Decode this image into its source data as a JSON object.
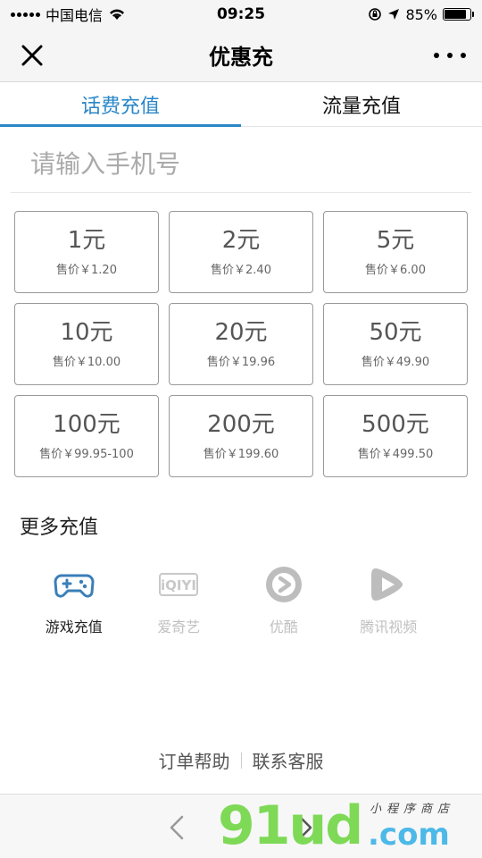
{
  "status_bar": {
    "carrier": "中国电信",
    "time": "09:25",
    "battery": "85%",
    "battery_level": 0.85
  },
  "nav": {
    "title": "优惠充",
    "close_icon": "close-icon",
    "more_icon": "more-dots-icon"
  },
  "tabs": [
    {
      "label": "话费充值",
      "active": true
    },
    {
      "label": "流量充值",
      "active": false
    }
  ],
  "phone_input": {
    "placeholder": "请输入手机号",
    "value": ""
  },
  "denominations": [
    {
      "amount": "1元",
      "price": "售价￥1.20"
    },
    {
      "amount": "2元",
      "price": "售价￥2.40"
    },
    {
      "amount": "5元",
      "price": "售价￥6.00"
    },
    {
      "amount": "10元",
      "price": "售价￥10.00"
    },
    {
      "amount": "20元",
      "price": "售价￥19.96"
    },
    {
      "amount": "50元",
      "price": "售价￥49.90"
    },
    {
      "amount": "100元",
      "price": "售价￥99.95-100"
    },
    {
      "amount": "200元",
      "price": "售价￥199.60"
    },
    {
      "amount": "500元",
      "price": "售价￥499.50"
    }
  ],
  "more": {
    "title": "更多充值",
    "items": [
      {
        "label": "游戏充值",
        "icon": "gamepad-icon",
        "enabled": true
      },
      {
        "label": "爱奇艺",
        "icon": "iqiyi-logo-icon",
        "enabled": false
      },
      {
        "label": "优酷",
        "icon": "youku-logo-icon",
        "enabled": false
      },
      {
        "label": "腾讯视频",
        "icon": "tencent-video-icon",
        "enabled": false
      }
    ]
  },
  "footer": {
    "order_help": "订单帮助",
    "contact_service": "联系客服"
  },
  "bottom_nav": {
    "back_icon": "chevron-left-icon",
    "forward_icon": "chevron-right-icon"
  },
  "watermark": {
    "main": "91ud",
    "com": ".com",
    "small": "小程序商店"
  },
  "colors": {
    "accent": "#2a87c8",
    "game_icon": "#3b7fb8",
    "disabled": "#c0c0c0"
  }
}
